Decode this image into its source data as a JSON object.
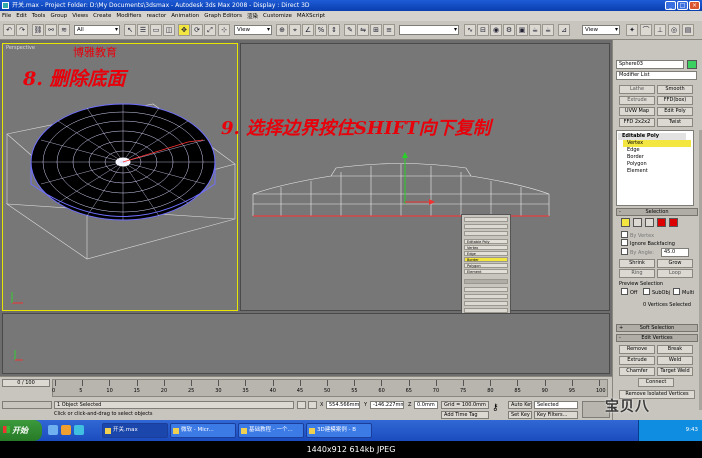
{
  "window": {
    "title": "开关.max - Project Folder: D:\\My Documents\\3dsmax - Autodesk 3ds Max 2008 - Display : Direct 3D",
    "min": "_",
    "max": "□",
    "close": "×"
  },
  "menu": [
    "File",
    "Edit",
    "Tools",
    "Group",
    "Views",
    "Create",
    "Modifiers",
    "reactor",
    "Animation",
    "Graph Editors",
    "渲染",
    "Customize",
    "MAXScript"
  ],
  "toolbar": {
    "selection_filter": "All",
    "ref_coord": "View",
    "ref_coord2": "View"
  },
  "viewports": {
    "left_label": "Perspective",
    "watermark_text": "博雅教育",
    "step8": "8. 删除底面",
    "step9": "9. 选择边界按住SHIFT向下复制"
  },
  "mini_panel": {
    "rows": [
      "Editable Poly",
      "Vertex",
      "Edge",
      "Border",
      "Polygon",
      "Element"
    ]
  },
  "command_panel": {
    "object_name": "Sphere03",
    "color": "#3cd060",
    "modifier_list": "Modifier List",
    "buttons": [
      {
        "a": "Lathe",
        "b": "Smooth"
      },
      {
        "a": "Extrude",
        "b": "FFD(box)"
      },
      {
        "a": "UVW Map",
        "b": "Edit Poly"
      },
      {
        "a": "FFD 2x2x2",
        "b": "Twist"
      }
    ],
    "stack": [
      "Editable Poly",
      "Vertex",
      "Edge",
      "Border",
      "Polygon",
      "Element"
    ],
    "rollouts": {
      "selection": "Selection",
      "soft_selection": "Soft Selection",
      "edit_vertices": "Edit Vertices"
    },
    "selection": {
      "by_vertex": "By Vertex",
      "ignore_backfacing": "Ignore Backfacing",
      "by_angle": "By Angle:",
      "angle_value": "45.0",
      "shrink": "Shrink",
      "grow": "Grow",
      "ring": "Ring",
      "loop": "Loop",
      "preview_selection": "Preview Selection",
      "off": "Off",
      "subobj": "SubObj",
      "multi": "Multi",
      "selected_count": "0 Vertices Selected"
    },
    "edit_vertices": {
      "remove": "Remove",
      "break": "Break",
      "extrude": "Extrude",
      "weld": "Weld",
      "chamfer": "Chamfer",
      "target_weld": "Target Weld",
      "connect": "Connect",
      "remove_isolated": "Remove Isolated Vertices"
    }
  },
  "timeline": {
    "frame_label": "0 / 100",
    "ticks": [
      "0",
      "5",
      "10",
      "15",
      "20",
      "25",
      "30",
      "35",
      "40",
      "45",
      "50",
      "55",
      "60",
      "65",
      "70",
      "75",
      "80",
      "85",
      "90",
      "95",
      "100"
    ]
  },
  "status": {
    "objects_selected": "1 Object Selected",
    "prompt": "Click or click-and-drag to select objects",
    "x_label": "X",
    "x_value": "554.566mm",
    "y_label": "Y",
    "y_value": "-146.227mm",
    "z_label": "Z",
    "z_value": "0.0mm",
    "grid": "Grid = 100.0mm",
    "add_time_tag": "Add Time Tag",
    "auto_key": "Auto Key",
    "set_key": "Set Key",
    "key_mode": "Selected",
    "key_filters": "Key Filters..."
  },
  "taskbar": {
    "start": "开始",
    "tasks": [
      "开关.max",
      "微软 - Micr...",
      "基础教程 - 一个...",
      "3D建模案例 - B"
    ],
    "clock": "9:43"
  },
  "overlay_watermark": "宝贝八",
  "caption": "1440x912  614kb  JPEG"
}
